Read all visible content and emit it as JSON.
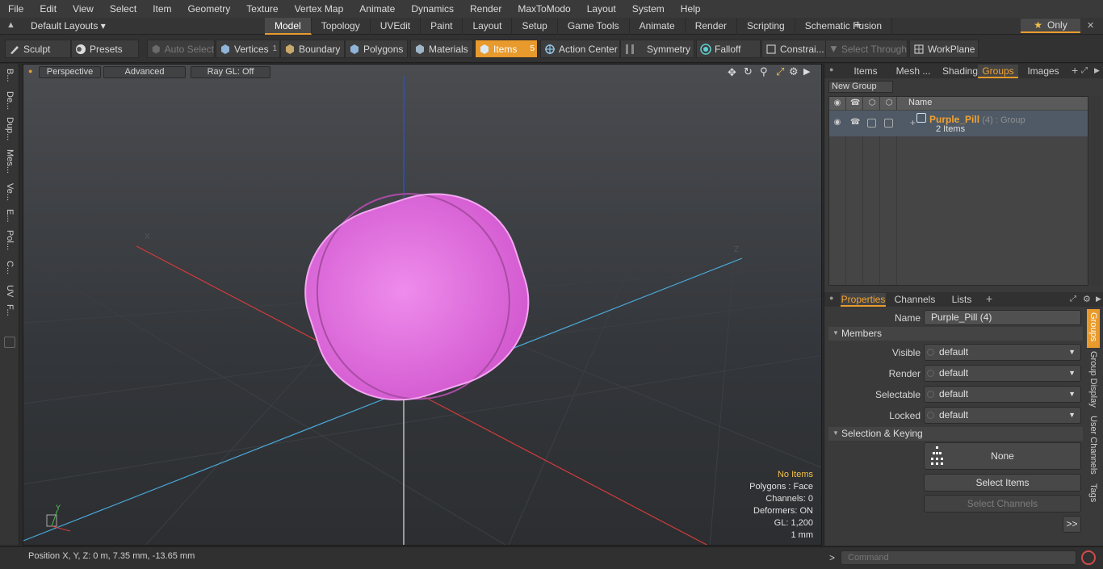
{
  "menu": [
    "File",
    "Edit",
    "View",
    "Select",
    "Item",
    "Geometry",
    "Texture",
    "Vertex Map",
    "Animate",
    "Dynamics",
    "Render",
    "MaxToModo",
    "Layout",
    "System",
    "Help"
  ],
  "layout": {
    "layouts_label": "Default Layouts",
    "tabs": [
      "Model",
      "Topology",
      "UVEdit",
      "Paint",
      "Layout",
      "Setup",
      "Game Tools",
      "Animate",
      "Render",
      "Scripting",
      "Schematic Fusion"
    ],
    "active_tab": "Model",
    "only_label": "Only"
  },
  "toolbar": {
    "sculpt": "Sculpt",
    "presets": "Presets",
    "auto_select": "Auto Select",
    "vertices": "Vertices",
    "vertices_count": "1",
    "boundary": "Boundary",
    "polygons": "Polygons",
    "materials": "Materials",
    "items": "Items",
    "items_count": "5",
    "action_center": "Action Center",
    "symmetry": "Symmetry",
    "falloff": "Falloff",
    "constraints": "Constrai...",
    "select_through": "Select Through",
    "workplane": "WorkPlane"
  },
  "left_strip": [
    "B...",
    "De...",
    "Dup...",
    "Mes...",
    "Ve...",
    "E...",
    "Pol...",
    "C...",
    "UV",
    "F..."
  ],
  "viewport": {
    "perspective": "Perspective",
    "advanced": "Advanced",
    "raygl": "Ray GL: Off",
    "axis_x": "X",
    "axis_z": "Z",
    "gizmo_y": "Y",
    "info": {
      "no_items": "No Items",
      "polygons": "Polygons : Face",
      "channels": "Channels: 0",
      "deformers": "Deformers: ON",
      "gl": "GL: 1,200",
      "scale": "1 mm"
    },
    "colors": {
      "pill": "#e36fe0",
      "x_axis": "#d23b3b",
      "y_axis": "#2a4fd8",
      "z_axis": "#4aa8d8"
    }
  },
  "status": {
    "position": "Position X, Y, Z:   0 m, 7.35 mm, -13.65 mm",
    "command_placeholder": "Command"
  },
  "top_panel": {
    "tabs": [
      "Items",
      "Mesh ...",
      "Shading",
      "Groups",
      "Images"
    ],
    "active_tab": "Groups",
    "new_group": "New Group",
    "column_name": "Name",
    "group": {
      "name": "Purple_Pill",
      "meta": "(4) : Group",
      "items": "2 Items"
    }
  },
  "properties": {
    "tabs": [
      "Properties",
      "Channels",
      "Lists"
    ],
    "active_tab": "Properties",
    "name_label": "Name",
    "name_value": "Purple_Pill (4)",
    "members_section": "Members",
    "fields": [
      {
        "label": "Visible",
        "value": "default"
      },
      {
        "label": "Render",
        "value": "default"
      },
      {
        "label": "Selectable",
        "value": "default"
      },
      {
        "label": "Locked",
        "value": "default"
      }
    ],
    "sel_section": "Selection & Keying",
    "none_btn": "None",
    "select_items": "Select Items",
    "select_channels": "Select Channels",
    "more": ">>",
    "side_tabs": [
      "Groups",
      "Group Display",
      "User Channels",
      "Tags"
    ]
  }
}
